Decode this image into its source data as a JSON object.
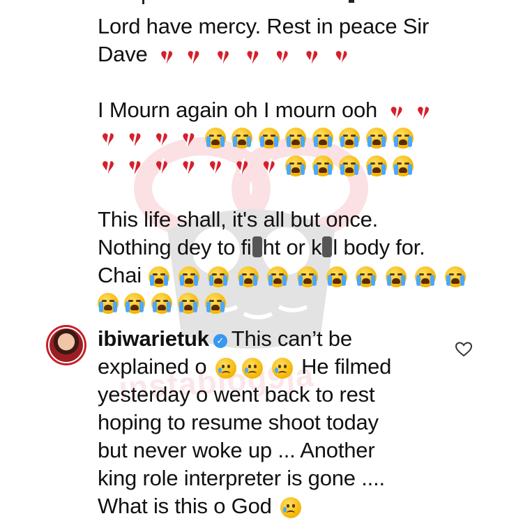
{
  "comment_one": {
    "paragraph_1": {
      "line_1": "Lord have mercy. Rest in peace Sir",
      "line_2": "Dave"
    },
    "paragraph_2": {
      "line_1": "I Mourn again oh I mourn ooh"
    },
    "paragraph_3": {
      "line_1": "This life shall, it's all but once.",
      "line_2_parts": [
        "Nothing dey to fi",
        "ht or k",
        "l body for."
      ],
      "line_3": "Chai"
    }
  },
  "reply": {
    "username": "ibiwarietuk",
    "verified_icon": "verified-badge-icon",
    "lines": [
      "This can’t be",
      "explained o",
      "He filmed",
      "yesterday o went back to rest",
      "hoping to resume shoot today",
      "but never woke up ... Another",
      "king role interpreter is gone ....",
      "What is this o God"
    ],
    "like_icon": "heart-outline-icon"
  },
  "watermark": {
    "text": "instablog9ja"
  },
  "colors": {
    "heart": "#d61f2c",
    "verified": "#3897f0",
    "avatar_ring": "#c81d25"
  }
}
